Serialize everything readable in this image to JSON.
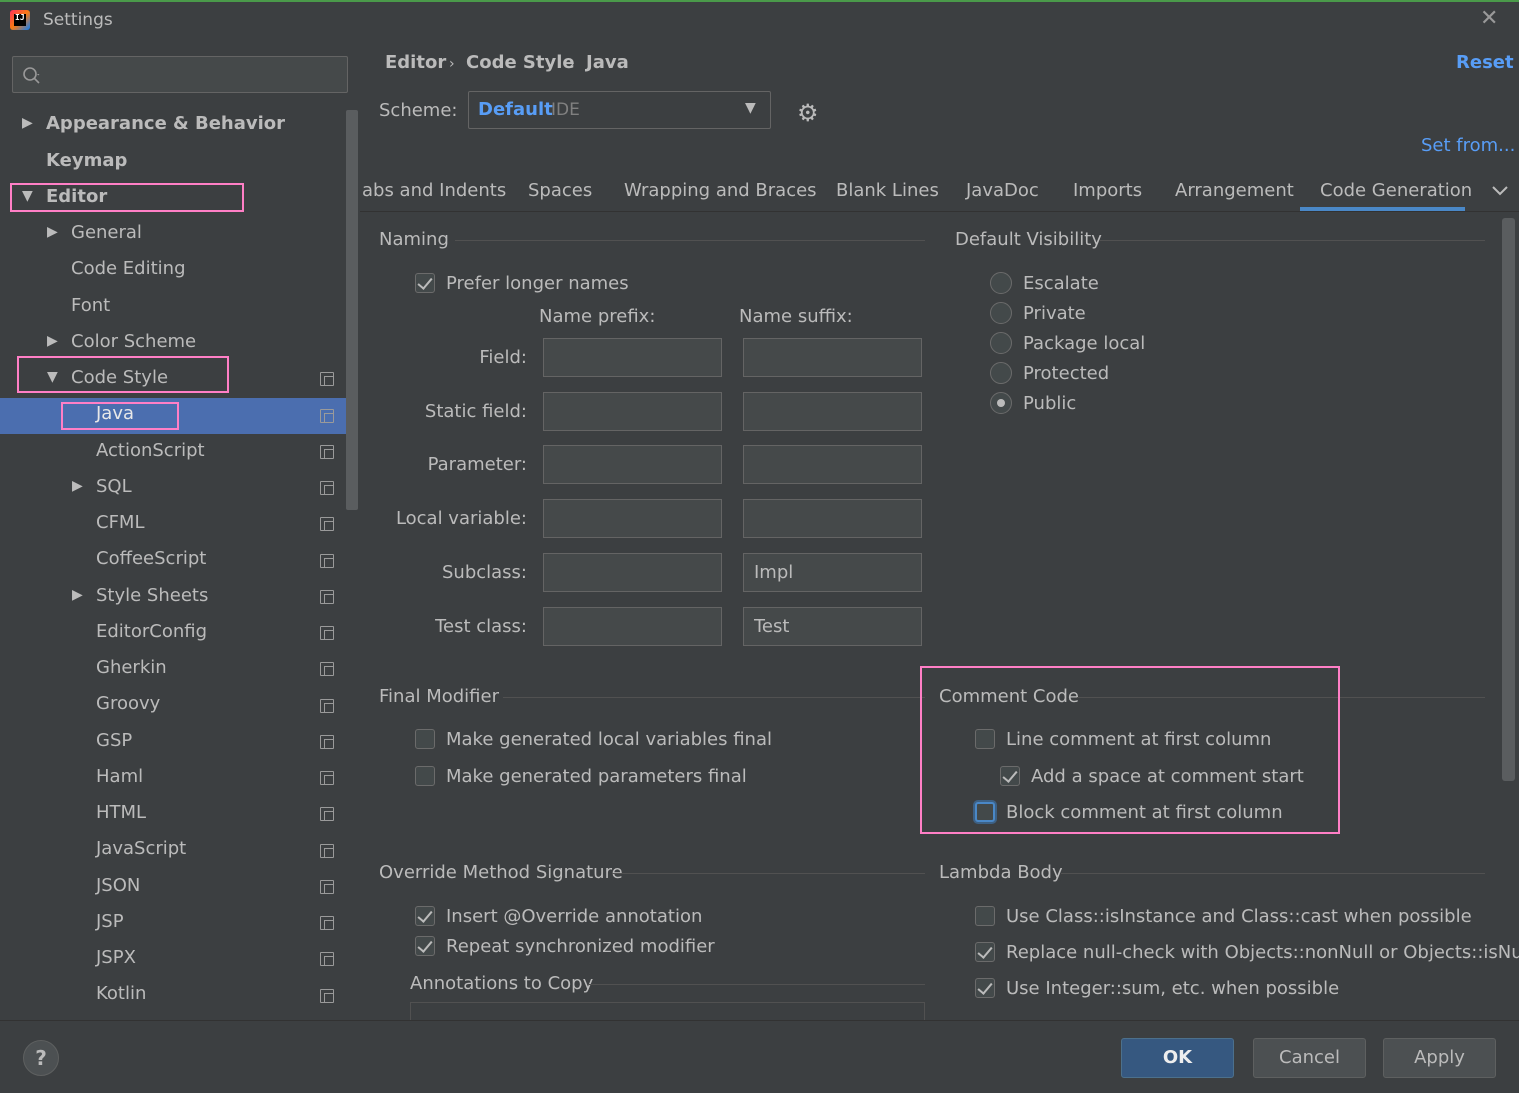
{
  "window": {
    "title": "Settings"
  },
  "search": {
    "placeholder": ""
  },
  "sidebar": {
    "top": [
      {
        "label": "Appearance & Behavior",
        "expandable": true
      },
      {
        "label": "Keymap",
        "expandable": false
      },
      {
        "label": "Editor",
        "expandable": true,
        "expanded": true
      }
    ],
    "editor_children": [
      {
        "label": "General"
      },
      {
        "label": "Code Editing"
      },
      {
        "label": "Font"
      },
      {
        "label": "Color Scheme"
      },
      {
        "label": "Code Style"
      }
    ],
    "code_style_children": [
      "Java",
      "ActionScript",
      "SQL",
      "CFML",
      "CoffeeScript",
      "Style Sheets",
      "EditorConfig",
      "Gherkin",
      "Groovy",
      "GSP",
      "Haml",
      "HTML",
      "JavaScript",
      "JSON",
      "JSP",
      "JSPX",
      "Kotlin"
    ]
  },
  "breadcrumb": {
    "a": "Editor",
    "b": "Code Style",
    "c": "Java",
    "sep": "›"
  },
  "header": {
    "reset": "Reset",
    "set_from": "Set from..."
  },
  "scheme": {
    "label": "Scheme:",
    "name": "Default",
    "kind": "IDE"
  },
  "tabs": [
    "abs and Indents",
    "Spaces",
    "Wrapping and Braces",
    "Blank Lines",
    "JavaDoc",
    "Imports",
    "Arrangement",
    "Code Generation"
  ],
  "naming": {
    "title": "Naming",
    "prefer_longer": "Prefer longer names",
    "prefix_header": "Name prefix:",
    "suffix_header": "Name suffix:",
    "rows": [
      {
        "label": "Field:",
        "prefix": "",
        "suffix": ""
      },
      {
        "label": "Static field:",
        "prefix": "",
        "suffix": ""
      },
      {
        "label": "Parameter:",
        "prefix": "",
        "suffix": ""
      },
      {
        "label": "Local variable:",
        "prefix": "",
        "suffix": ""
      },
      {
        "label": "Subclass:",
        "prefix": "",
        "suffix": "Impl"
      },
      {
        "label": "Test class:",
        "prefix": "",
        "suffix": "Test"
      }
    ]
  },
  "visibility": {
    "title": "Default Visibility",
    "options": [
      "Escalate",
      "Private",
      "Package local",
      "Protected",
      "Public"
    ],
    "selected": "Public"
  },
  "final_modifier": {
    "title": "Final Modifier",
    "local_vars": "Make generated local variables final",
    "params": "Make generated parameters final"
  },
  "comment_code": {
    "title": "Comment Code",
    "line_first": "Line comment at first column",
    "add_space": "Add a space at comment start",
    "block_first": "Block comment at first column"
  },
  "override": {
    "title": "Override Method Signature",
    "insert": "Insert @Override annotation",
    "repeat": "Repeat synchronized modifier",
    "annotations_title": "Annotations to Copy"
  },
  "lambda": {
    "title": "Lambda Body",
    "isinstance": "Use Class::isInstance and Class::cast when possible",
    "nullcheck": "Replace null-check with Objects::nonNull or Objects::isNull",
    "integer_sum": "Use Integer::sum, etc. when possible"
  },
  "buttons": {
    "help": "?",
    "ok": "OK",
    "cancel": "Cancel",
    "apply": "Apply"
  },
  "colors": {
    "selection": "#4b6eaf",
    "link": "#589df6",
    "highlight_box": "#ff7fc6"
  }
}
